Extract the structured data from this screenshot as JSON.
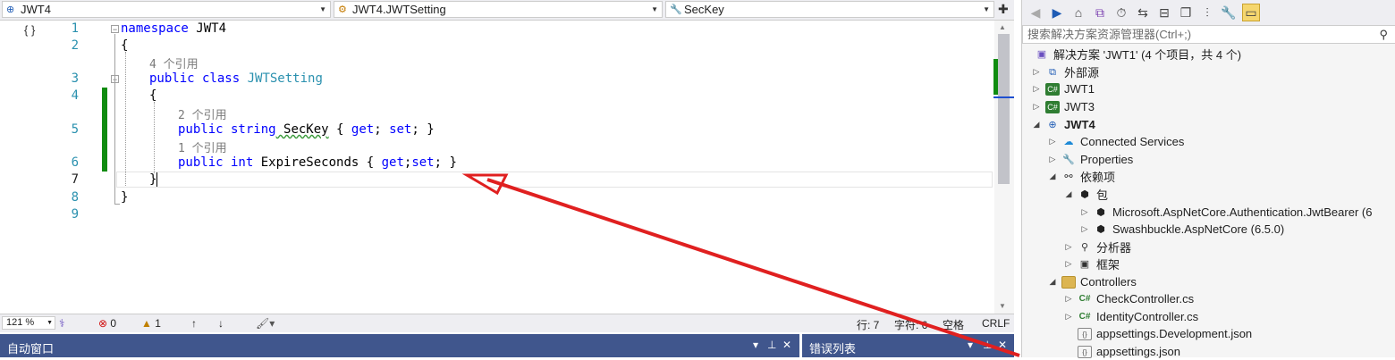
{
  "nav": {
    "project": "JWT4",
    "class": "JWT4.JWTSetting",
    "member": "SecKey"
  },
  "editor": {
    "line_numbers": [
      "1",
      "2",
      "3",
      "4",
      "5",
      "6",
      "7",
      "8",
      "9"
    ],
    "refs": {
      "class_refs": "4 个引用",
      "seckey_refs": "2 个引用",
      "expire_refs": "1 个引用"
    },
    "code": {
      "l1_kw": "namespace",
      "l1_name": " JWT4",
      "l2": "{",
      "l3_kw1": "public",
      "l3_kw2": " class",
      "l3_name": " JWTSetting",
      "l4": "{",
      "l5_kw1": "public",
      "l5_kw2": " string",
      "l5_name": " SecKey",
      "l5_b1": " { ",
      "l5_get": "get",
      "l5_s1": "; ",
      "l5_set": "set",
      "l5_b2": "; }",
      "l6_kw1": "public",
      "l6_kw2": " int",
      "l6_name": " ExpireSeconds { ",
      "l6_get": "get",
      "l6_s1": ";",
      "l6_set": "set",
      "l6_b2": "; }",
      "l7": "}",
      "l8": "}"
    }
  },
  "status": {
    "zoom": "121 %",
    "errors": "0",
    "warnings": "1",
    "row": "行: 7",
    "col": "字符: 6",
    "spaces": "空格",
    "eol": "CRLF"
  },
  "panels": {
    "auto_window": "自动窗口",
    "error_list": "错误列表"
  },
  "solution_explorer": {
    "search_placeholder": "搜索解决方案资源管理器(Ctrl+;)",
    "solution": "解决方案 'JWT1' (4 个项目，共 4 个)",
    "items": {
      "external": "外部源",
      "jwt1": "JWT1",
      "jwt3": "JWT3",
      "jwt4": "JWT4",
      "connected": "Connected Services",
      "properties": "Properties",
      "deps": "依赖项",
      "packages": "包",
      "pkg1": "Microsoft.AspNetCore.Authentication.JwtBearer (6",
      "pkg2": "Swashbuckle.AspNetCore (6.5.0)",
      "analyzers": "分析器",
      "frameworks": "框架",
      "controllers": "Controllers",
      "check": "CheckController.cs",
      "identity": "IdentityController.cs",
      "appsettings_dev": "appsettings.Development.json",
      "appsettings": "appsettings.json"
    }
  },
  "colors": {
    "accent": "#40568d",
    "change_bar": "#108c10",
    "keyword": "#0000ff",
    "type": "#2b91af",
    "arrow": "#e02020"
  }
}
